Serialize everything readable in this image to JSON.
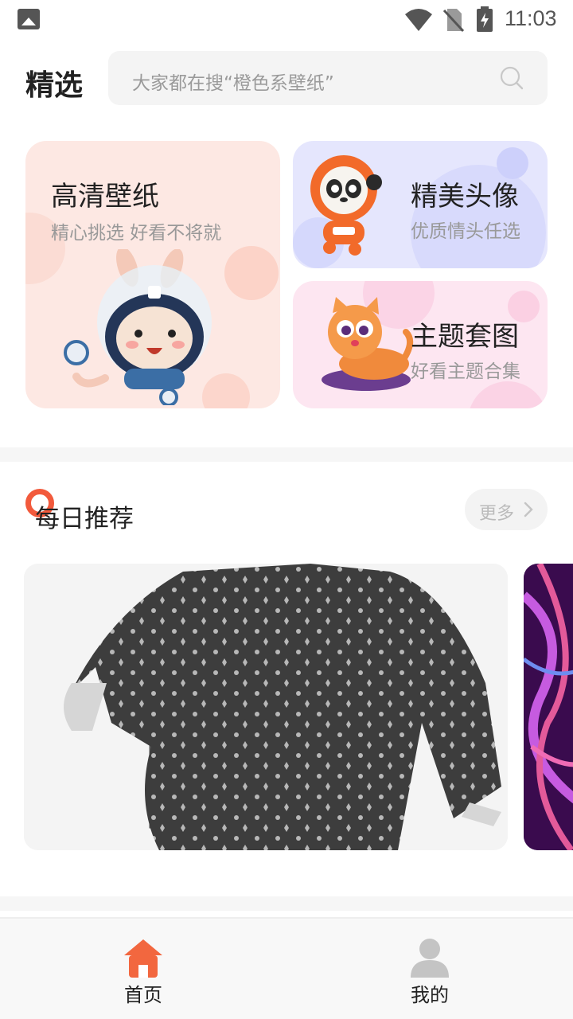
{
  "status_bar": {
    "time": "11:03",
    "icons": [
      "gallery-icon",
      "wifi-icon",
      "no-sim-icon",
      "battery-charging-icon"
    ]
  },
  "header": {
    "title": "精选",
    "search_placeholder": "大家都在搜“橙色系壁纸”",
    "search_icon": "search-icon"
  },
  "features": {
    "hd": {
      "title": "高清壁纸",
      "subtitle": "精心挑选 好看不将就",
      "illustration": "astronaut-bunny"
    },
    "avatar": {
      "title": "精美头像",
      "subtitle": "优质情头任选",
      "illustration": "astronaut-panda"
    },
    "theme": {
      "title": "主题套图",
      "subtitle": "好看主题合集",
      "illustration": "orange-cat"
    }
  },
  "daily": {
    "title": "每日推荐",
    "more_label": "更多"
  },
  "bottom_nav": {
    "items": [
      {
        "label": "首页",
        "icon": "home-icon",
        "active": true
      },
      {
        "label": "我的",
        "icon": "person-icon",
        "active": false
      }
    ]
  },
  "colors": {
    "accent": "#f2673f",
    "hd_card": "#fde8e3",
    "avatar_card": "#e5e6fd",
    "theme_card": "#fde6f1",
    "inactive_icon": "#c4c4c4"
  }
}
